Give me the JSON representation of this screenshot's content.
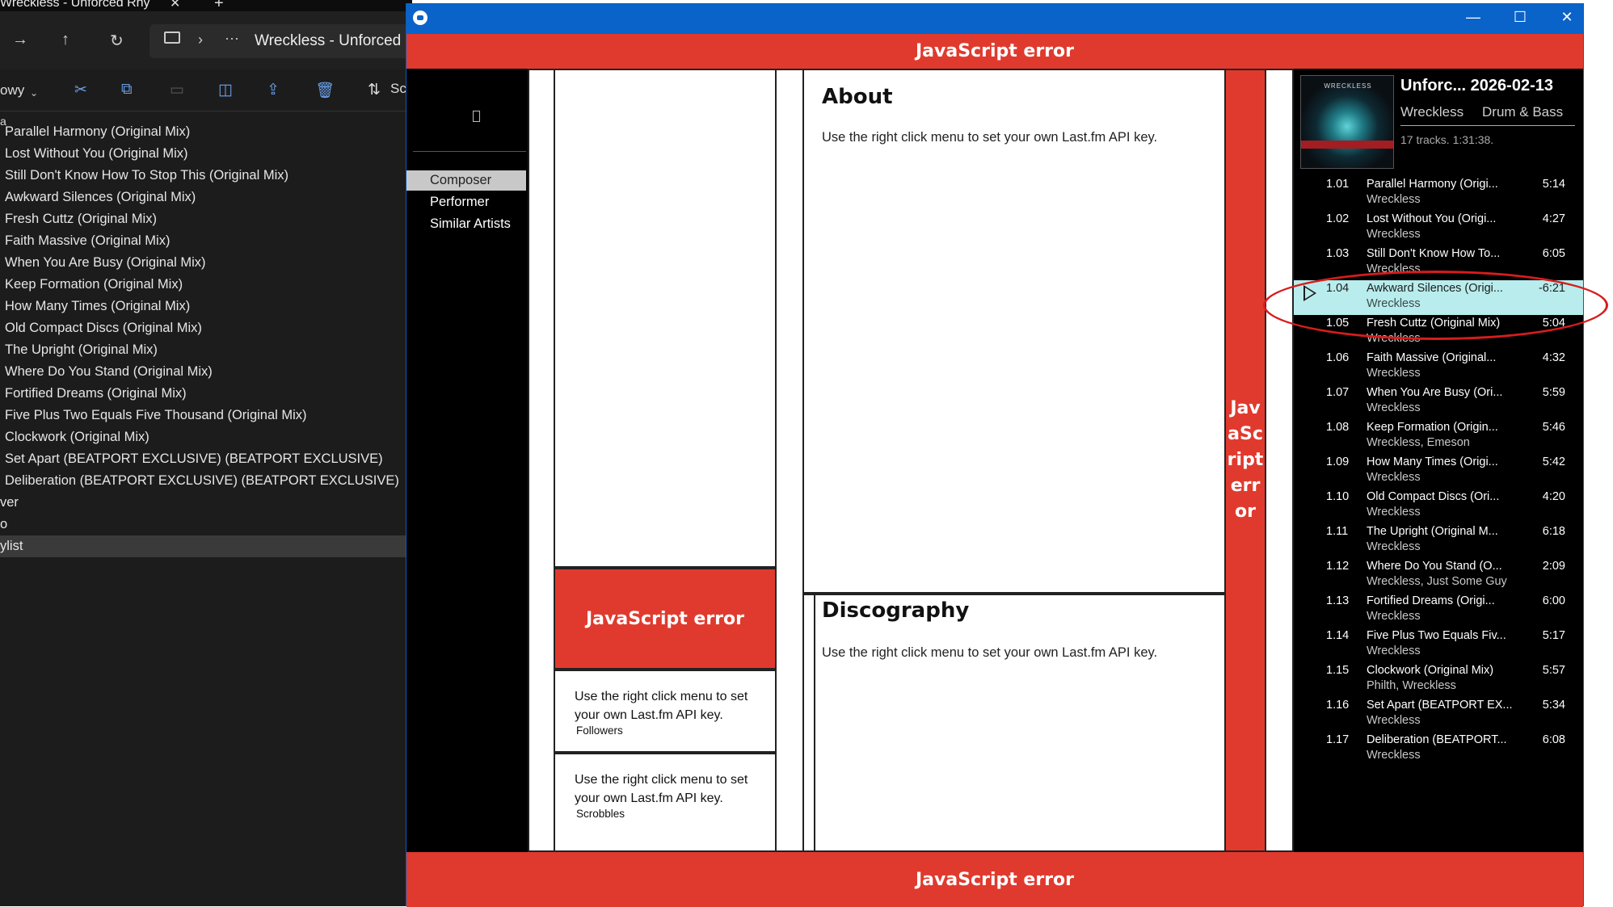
{
  "explorer": {
    "tab_title": "Wreckless - Unforced Rhy",
    "address_path": "Wreckless - Unforced",
    "new_label": "owy",
    "sort_label": "Sc",
    "breadcrumb_fragment": "a",
    "files": [
      "Parallel Harmony  (Original Mix)",
      "Lost Without You  (Original Mix)",
      "Still Don't Know How To Stop This  (Original Mix)",
      "Awkward Silences  (Original Mix)",
      "Fresh Cuttz  (Original Mix)",
      "Faith Massive  (Original Mix)",
      "When You Are Busy  (Original Mix)",
      "Keep Formation  (Original Mix)",
      "How Many Times  (Original Mix)",
      "Old Compact Discs  (Original Mix)",
      "The Upright  (Original Mix)",
      "Where Do You Stand  (Original Mix)",
      "Fortified Dreams  (Original Mix)",
      "Five Plus Two Equals Five Thousand  (Original Mix)",
      "Clockwork  (Original Mix)",
      "Set Apart (BEATPORT EXCLUSIVE) (BEATPORT EXCLUSIVE)",
      "Deliberation (BEATPORT EXCLUSIVE) (BEATPORT EXCLUSIVE)",
      "ver",
      "o",
      "ylist"
    ]
  },
  "app": {
    "error_text": "JavaScript error",
    "side_error_text": "JavaScript error",
    "sidebar": [
      "Composer",
      "Performer",
      "Similar Artists"
    ],
    "about_title": "About",
    "about_text": "Use the right click menu to set your own Last.fm API key.",
    "discography_title": "Discography",
    "discography_text": "Use the right click menu to set your own Last.fm API key.",
    "followers_text": "Use the right click menu to set your own Last.fm API key.",
    "followers_label": "Followers",
    "scrobbles_text": "Use the right click menu to set your own Last.fm API key.",
    "scrobbles_label": "Scrobbles",
    "album": {
      "title": "Unforc... 2026-02-13",
      "artist": "Wreckless",
      "genre": "Drum & Bass",
      "meta": "17 tracks. 1:31:38.",
      "cover_text": "WRECKLESS",
      "tracks": [
        {
          "num": "1.01",
          "title": "Parallel Harmony  (Origi...",
          "artist": "Wreckless",
          "dur": "5:14"
        },
        {
          "num": "1.02",
          "title": "Lost Without You  (Origi...",
          "artist": "Wreckless",
          "dur": "4:27"
        },
        {
          "num": "1.03",
          "title": "Still Don't Know How To...",
          "artist": "Wreckless",
          "dur": "6:05"
        },
        {
          "num": "1.04",
          "title": "Awkward Silences  (Origi...",
          "artist": "Wreckless",
          "dur": "-6:21",
          "playing": true
        },
        {
          "num": "1.05",
          "title": "Fresh Cuttz  (Original Mix)",
          "artist": "Wreckless",
          "dur": "5:04"
        },
        {
          "num": "1.06",
          "title": "Faith Massive  (Original...",
          "artist": "Wreckless",
          "dur": "4:32"
        },
        {
          "num": "1.07",
          "title": "When You Are Busy  (Ori...",
          "artist": "Wreckless",
          "dur": "5:59"
        },
        {
          "num": "1.08",
          "title": "Keep Formation  (Origin...",
          "artist": "Wreckless, Emeson",
          "dur": "5:46"
        },
        {
          "num": "1.09",
          "title": "How Many Times  (Origi...",
          "artist": "Wreckless",
          "dur": "5:42"
        },
        {
          "num": "1.10",
          "title": "Old Compact Discs  (Ori...",
          "artist": "Wreckless",
          "dur": "4:20"
        },
        {
          "num": "1.11",
          "title": "The Upright  (Original M...",
          "artist": "Wreckless",
          "dur": "6:18"
        },
        {
          "num": "1.12",
          "title": "Where Do You Stand  (O...",
          "artist": "Wreckless, Just Some Guy",
          "dur": "2:09"
        },
        {
          "num": "1.13",
          "title": "Fortified Dreams  (Origi...",
          "artist": "Wreckless",
          "dur": "6:00"
        },
        {
          "num": "1.14",
          "title": "Five Plus Two Equals Fiv...",
          "artist": "Wreckless",
          "dur": "5:17"
        },
        {
          "num": "1.15",
          "title": "Clockwork  (Original Mix)",
          "artist": "Philth, Wreckless",
          "dur": "5:57"
        },
        {
          "num": "1.16",
          "title": "Set Apart (BEATPORT EX...",
          "artist": "Wreckless",
          "dur": "5:34"
        },
        {
          "num": "1.17",
          "title": "Deliberation (BEATPORT...",
          "artist": "Wreckless",
          "dur": "6:08"
        }
      ]
    }
  },
  "colors": {
    "error_red": "#e03a2e",
    "titlebar_blue": "#0a63c9",
    "playing_highlight": "#b9ecec",
    "annotation": "#d61c1c"
  },
  "icons": {
    "window": [
      "app-icon",
      "minimize-icon",
      "maximize-icon",
      "close-icon"
    ],
    "explorer": [
      "forward-icon",
      "up-icon",
      "refresh-icon",
      "monitor-icon",
      "cut-icon",
      "copy-icon",
      "paste-icon",
      "rename-icon",
      "share-icon",
      "delete-icon",
      "sort-icon"
    ]
  }
}
